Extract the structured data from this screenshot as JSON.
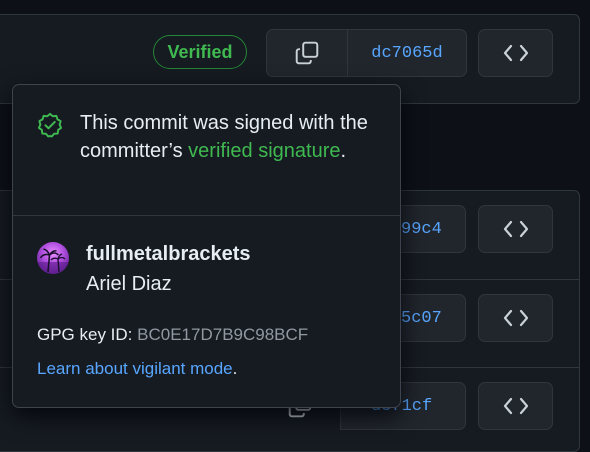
{
  "commit_row": {
    "badge_label": "Verified",
    "sha": "dc7065d"
  },
  "other_rows": [
    {
      "sha_partial": "99c4"
    },
    {
      "sha_partial": "5c07"
    },
    {
      "sha_partial": "d5f1cf"
    }
  ],
  "popover": {
    "message_before": "This commit was signed with the committer’s ",
    "message_link": "verified signature",
    "message_after": ".",
    "username": "fullmetalbrackets",
    "full_name": "Ariel Diaz",
    "gpg_label": "GPG key ID: ",
    "gpg_key": "BC0E17D7B9C98BCF",
    "learn_link": "Learn about vigilant mode",
    "learn_after": "."
  },
  "colors": {
    "verified_green": "#3fb950",
    "link_blue": "#58a6ff"
  },
  "icons": [
    "check-shield-icon",
    "copy-icon",
    "code-icon"
  ]
}
